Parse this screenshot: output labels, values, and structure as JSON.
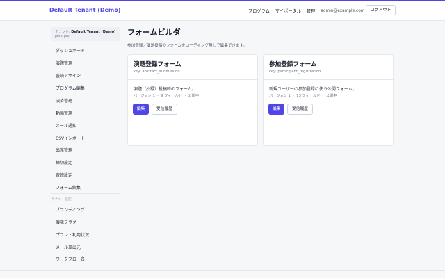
{
  "header": {
    "brand": "Default Tenant (Demo)",
    "nav": [
      "プログラム",
      "マイポータル",
      "管理"
    ],
    "email": "admin@example.com",
    "logout": "ログアウト"
  },
  "sidebar": {
    "tenant_prefix": "テナント:",
    "tenant_name": "Default Tenant (Demo)",
    "plan": "plan: pro",
    "items": [
      "ダッシュボード",
      "演題管理",
      "査読アサイン",
      "プログラム編集",
      "決済管理",
      "動画管理",
      "メール通知",
      "CSVインポート",
      "出席管理",
      "締切設定",
      "査読設定",
      "フォーム編集"
    ],
    "section_title": "テナント設定",
    "settings_items": [
      "ブランディング",
      "機能フラグ",
      "プラン・利用状況",
      "メール差出元",
      "ワークフロー名"
    ]
  },
  "main": {
    "title": "フォームビルダ",
    "description": "参加登録／演題投稿のフォームをコーディング無しで編集できます。",
    "cards": [
      {
        "title": "演題登録フォーム",
        "key": "key: abstract_submission",
        "desc": "演題（抄録）投稿時のフォーム。",
        "meta": "バージョン 1 ・ 9 フィールド ・ 公開中",
        "edit": "編集",
        "history": "受信履歴"
      },
      {
        "title": "参加登録フォーム",
        "key": "key: participant_registration",
        "desc": "新規ユーザーの参加登録に使う公開フォーム。",
        "meta": "バージョン 1 ・ 13 フィールド ・ 公開中",
        "edit": "編集",
        "history": "受信履歴"
      }
    ]
  },
  "colors": {
    "accent": "#4f46e5",
    "background": "#f6f7f9",
    "card": "#ffffff",
    "border": "#e5e7eb"
  }
}
